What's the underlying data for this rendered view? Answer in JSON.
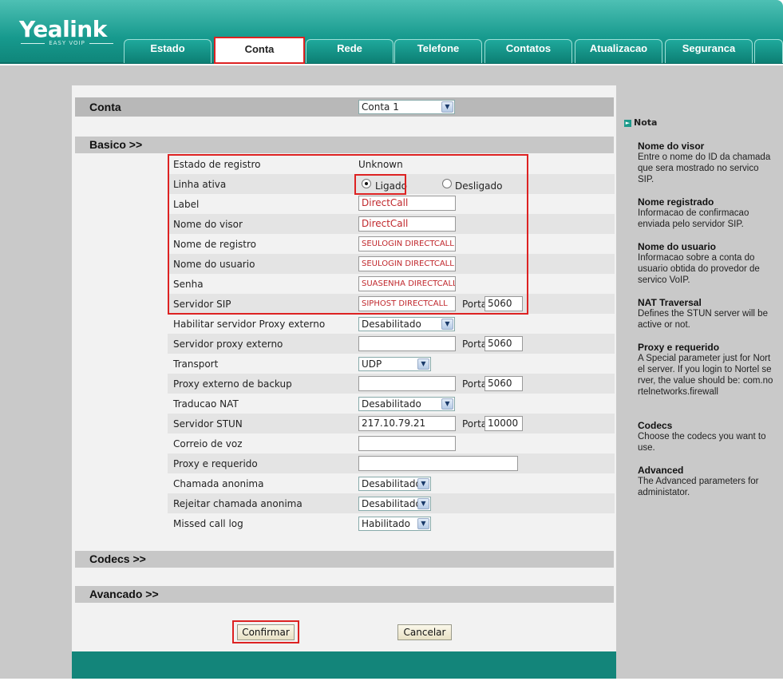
{
  "brand": {
    "logo": "Yealink",
    "sub": "EASY VOIP"
  },
  "tabs": [
    "Estado",
    "Conta",
    "Rede",
    "Telefone",
    "Contatos",
    "Atualizacao",
    "Seguranca"
  ],
  "account": {
    "title": "Conta",
    "selected": "Conta 1"
  },
  "sections": {
    "basico": "Basico >>",
    "codecs": "Codecs >>",
    "avancado": "Avancado >>"
  },
  "fields": {
    "estado_registro": {
      "label": "Estado de registro",
      "value": "Unknown"
    },
    "linha_ativa": {
      "label": "Linha ativa",
      "on": "Ligado",
      "off": "Desligado"
    },
    "label": {
      "label": "Label",
      "value": "DirectCall"
    },
    "nome_visor": {
      "label": "Nome do visor",
      "value": "DirectCall"
    },
    "nome_registro": {
      "label": "Nome de registro",
      "value": "SEULOGIN DIRECTCALL"
    },
    "nome_usuario": {
      "label": "Nome do usuario",
      "value": "SEULOGIN DIRECTCALL"
    },
    "senha": {
      "label": "Senha",
      "value": "SUASENHA DIRECTCALL"
    },
    "servidor_sip": {
      "label": "Servidor SIP",
      "value": "SIPHOST DIRECTCALL",
      "port": "5060"
    },
    "proxy_ext_enable": {
      "label": "Habilitar servidor Proxy externo",
      "value": "Desabilitado"
    },
    "proxy_ext": {
      "label": "Servidor proxy externo",
      "value": "",
      "port": "5060"
    },
    "transport": {
      "label": "Transport",
      "value": "UDP"
    },
    "proxy_backup": {
      "label": "Proxy externo de backup",
      "value": "",
      "port": "5060"
    },
    "nat": {
      "label": "Traducao NAT",
      "value": "Desabilitado"
    },
    "stun": {
      "label": "Servidor STUN",
      "value": "217.10.79.21",
      "port": "10000"
    },
    "voicemail": {
      "label": "Correio de voz",
      "value": ""
    },
    "proxy_req": {
      "label": "Proxy e requerido",
      "value": ""
    },
    "anon": {
      "label": "Chamada anonima",
      "value": "Desabilitado"
    },
    "reject_anon": {
      "label": "Rejeitar chamada anonima",
      "value": "Desabilitado"
    },
    "missed": {
      "label": "Missed call log",
      "value": "Habilitado"
    }
  },
  "porta_label": "Porta",
  "buttons": {
    "confirm": "Confirmar",
    "cancel": "Cancelar"
  },
  "nota": {
    "title": "Nota",
    "items": [
      {
        "t": "Nome do visor",
        "d": "Entre o nome do ID da chamada que sera mostrado no servico SIP."
      },
      {
        "t": "Nome registrado",
        "d": "Informacao de confirmacao enviada pelo servidor SIP."
      },
      {
        "t": "Nome do usuario",
        "d": "Informacao sobre a conta do usuario obtida do provedor de servico VoIP."
      },
      {
        "t": "NAT Traversal",
        "d": "Defines the STUN server will be active or not."
      },
      {
        "t": "Proxy e requerido",
        "d": "A Special parameter just for Nortel server. If you login to Nortel server, the value should be: com.nortelnetworks.firewall"
      },
      {
        "t": "Codecs",
        "d": "Choose the codecs you want to use."
      },
      {
        "t": "Advanced",
        "d": "The Advanced parameters for administator."
      }
    ]
  },
  "colors": {
    "teal": "#179a8e",
    "highlight": "#dd2222",
    "field_text": "#c0282d"
  }
}
